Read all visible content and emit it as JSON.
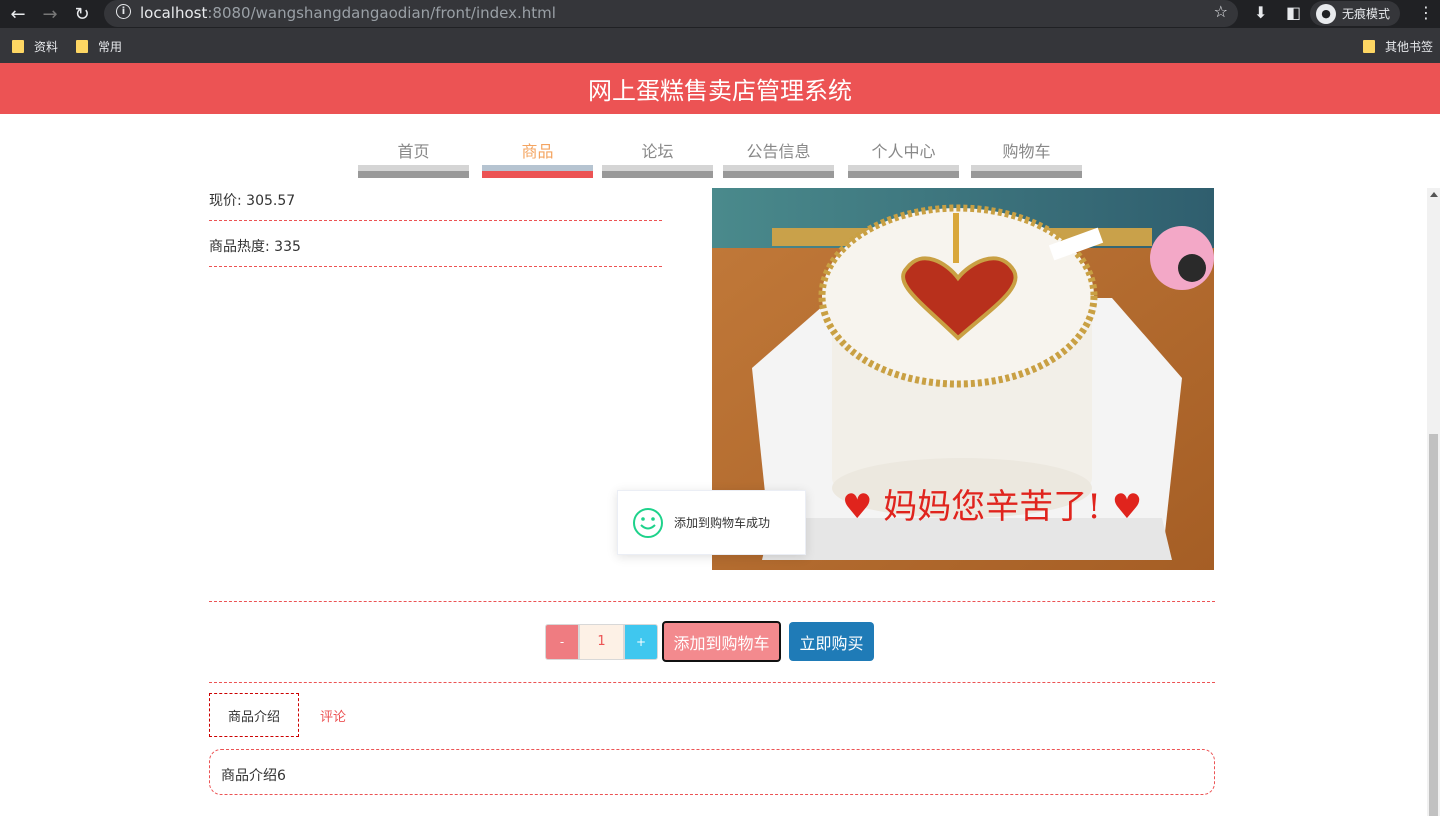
{
  "browser": {
    "url_host": "localhost",
    "url_rest": ":8080/wangshangdangaodian/front/index.html",
    "incognito_label": "无痕模式",
    "bookmarks": [
      "资料",
      "常用"
    ],
    "other_bookmarks": "其他书签"
  },
  "header": {
    "title": "网上蛋糕售卖店管理系统"
  },
  "nav": {
    "items": [
      {
        "label": "首页",
        "active": false
      },
      {
        "label": "商品",
        "active": true
      },
      {
        "label": "论坛",
        "active": false
      },
      {
        "label": "公告信息",
        "active": false
      },
      {
        "label": "个人中心",
        "active": false
      },
      {
        "label": "购物车",
        "active": false
      }
    ]
  },
  "product": {
    "price_text": "现价: 305.57",
    "heat_text": "商品热度: 335",
    "image_icon": "cake-photo"
  },
  "toast": {
    "icon": "smile-icon",
    "message": "添加到购物车成功",
    "color": "#1ed28b"
  },
  "purchase": {
    "minus_label": "-",
    "quantity": "1",
    "plus_label": "+",
    "add_cart_label": "添加到购物车",
    "buy_now_label": "立即购买"
  },
  "tabs": [
    {
      "label": "商品介绍",
      "active": true
    },
    {
      "label": "评论",
      "active": false
    }
  ],
  "intro": {
    "content": "商品介绍6"
  },
  "colors": {
    "brand": "#ec5354",
    "buy": "#1f7bb7",
    "plus": "#3fc7ef"
  }
}
